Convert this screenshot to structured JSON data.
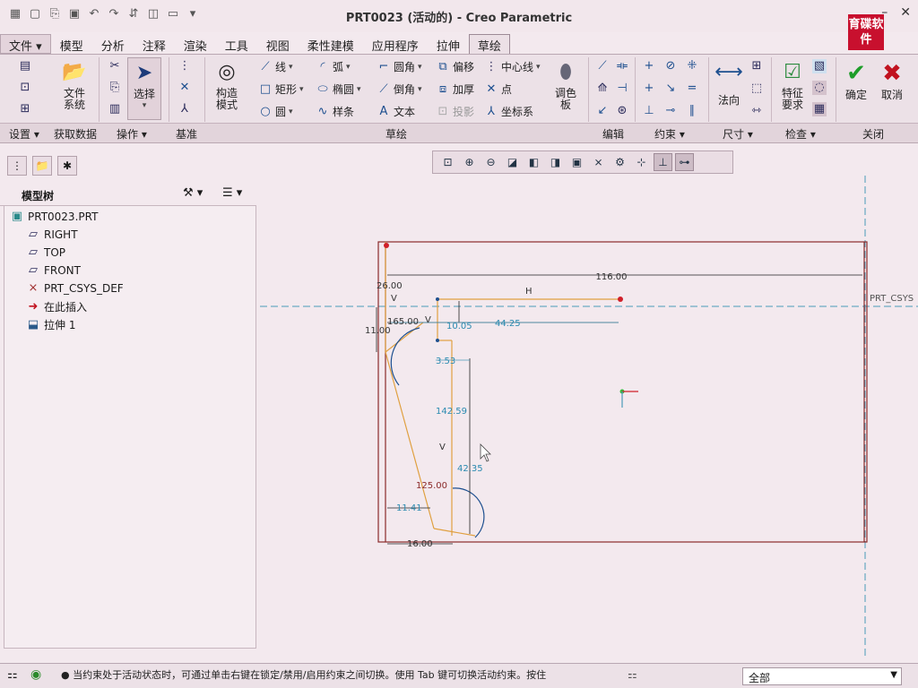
{
  "window": {
    "title": "PRT0023 (活动的) - Creo Parametric",
    "logo_text": "育碟软件"
  },
  "tabs": [
    "文件",
    "模型",
    "分析",
    "注释",
    "渲染",
    "工具",
    "视图",
    "柔性建模",
    "应用程序",
    "拉伸",
    "草绘"
  ],
  "ribbon": {
    "file_system": "文件系统",
    "select": "选择",
    "construction_mode": "构造模式",
    "line": "线",
    "arc": "弧",
    "fillet": "圆角",
    "offset": "偏移",
    "centerline": "中心线",
    "rectangle": "矩形",
    "ellipse": "椭圆",
    "chamfer": "倒角",
    "thicken": "加厚",
    "point": "点",
    "circle": "圆",
    "spline": "样条",
    "text": "文本",
    "project": "投影",
    "coord_sys": "坐标系",
    "palette": "调色板",
    "normal": "法向",
    "feature_req": "特征要求",
    "ok": "确定",
    "cancel": "取消",
    "groups": {
      "setup": "设置",
      "get_data": "获取数据",
      "operations": "操作",
      "datum": "基准",
      "sketch": "草绘",
      "edit": "编辑",
      "constrain": "约束",
      "dimension": "尺寸",
      "inspect": "检查",
      "close": "关闭"
    }
  },
  "model_tree": {
    "title": "模型树",
    "items": [
      "PRT0023.PRT",
      "RIGHT",
      "TOP",
      "FRONT",
      "PRT_CSYS_DEF",
      "在此插入",
      "拉伸 1"
    ]
  },
  "sketch": {
    "dims": [
      "116.00",
      "26.00",
      "11.00",
      "165.00",
      "10.05",
      "44.25",
      "3.53",
      "142.59",
      "42.35",
      "125.00",
      "11.41",
      "16.00"
    ],
    "labels": [
      "V",
      "H",
      "V",
      "V"
    ],
    "csys_label": "PRT_CSYS"
  },
  "status": {
    "message": "● 当约束处于活动状态时，可通过单击右键在锁定/禁用/启用约束之间切换。使用 Tab 键可切换活动约束。按住",
    "filter": "全部"
  }
}
